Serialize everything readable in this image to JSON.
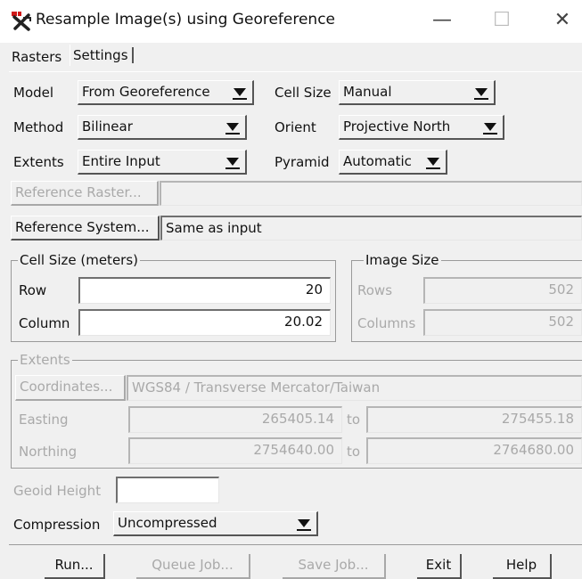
{
  "window": {
    "title": "Resample Image(s) using Georeference",
    "minimize_glyph": "—",
    "maximize_glyph": "☐",
    "close_glyph": "✕"
  },
  "tabs": [
    {
      "label": "Rasters"
    },
    {
      "label": "Settings"
    }
  ],
  "settings": {
    "model_label": "Model",
    "model_value": "From Georeference",
    "method_label": "Method",
    "method_value": "Bilinear",
    "extents_label": "Extents",
    "extents_value": "Entire Input",
    "cellsize_label": "Cell Size",
    "cellsize_value": "Manual",
    "orient_label": "Orient",
    "orient_value": "Projective North",
    "pyramid_label": "Pyramid",
    "pyramid_value": "Automatic",
    "reference_raster_button": "Reference Raster...",
    "reference_raster_value": "",
    "reference_system_button": "Reference System...",
    "reference_system_value": "Same as input"
  },
  "cell_size_group": {
    "title": "Cell Size (meters)",
    "row_label": "Row",
    "row_value": "20",
    "column_label": "Column",
    "column_value": "20.02"
  },
  "image_size_group": {
    "title": "Image Size",
    "rows_label": "Rows",
    "rows_value": "502",
    "columns_label": "Columns",
    "columns_value": "502"
  },
  "extents_group": {
    "title": "Extents",
    "coordinates_button": "Coordinates...",
    "coordinates_value": "WGS84 / Transverse Mercator/Taiwan",
    "easting_label": "Easting",
    "easting_from": "265405.14",
    "easting_to": "275455.18",
    "northing_label": "Northing",
    "northing_from": "2754640.00",
    "northing_to": "2764680.00",
    "to_label": "to"
  },
  "geoid": {
    "label": "Geoid Height",
    "value": ""
  },
  "compression": {
    "label": "Compression",
    "value": "Uncompressed"
  },
  "buttons": {
    "run": "Run...",
    "queue": "Queue Job...",
    "save": "Save Job...",
    "exit": "Exit",
    "help": "Help"
  },
  "colors": {
    "background": "#f0f0f0",
    "disabled_text": "#a9a9a9",
    "icon_red": "#d01818",
    "icon_dark": "#222222"
  }
}
